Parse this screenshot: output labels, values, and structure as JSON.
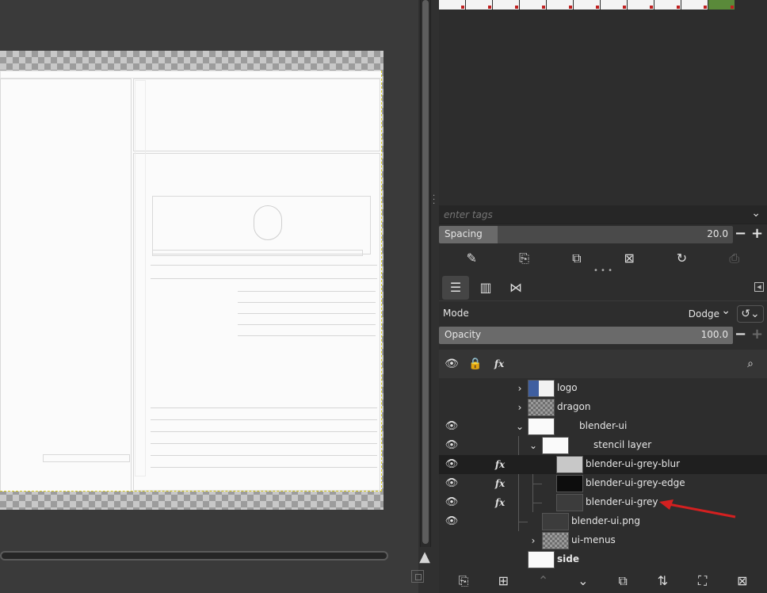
{
  "brushes": {
    "tags_placeholder": "enter tags",
    "spacing_label": "Spacing",
    "spacing_value": "20.0",
    "spacing_fraction": 0.2
  },
  "layers": {
    "mode_label": "Mode",
    "mode_value": "Dodge",
    "opacity_label": "Opacity",
    "opacity_value": "100.0",
    "opacity_fraction": 1.0,
    "items": [
      {
        "name": "logo",
        "visible": false,
        "fx": false,
        "expander": "›",
        "thumb": "t-logo"
      },
      {
        "name": "dragon",
        "visible": false,
        "fx": false,
        "expander": "›",
        "thumb": "t-checker"
      },
      {
        "name": "blender-ui",
        "visible": true,
        "fx": false,
        "expander": "⌄",
        "thumb": "t-white"
      },
      {
        "name": "stencil layer",
        "visible": true,
        "fx": false,
        "expander": "⌄",
        "thumb": "t-white"
      },
      {
        "name": "blender-ui-grey-blur",
        "visible": true,
        "fx": true,
        "expander": "",
        "thumb": "t-grey"
      },
      {
        "name": "blender-ui-grey-edge",
        "visible": true,
        "fx": true,
        "expander": "",
        "thumb": "t-black"
      },
      {
        "name": "blender-ui-grey",
        "visible": true,
        "fx": true,
        "expander": "",
        "thumb": "t-dark"
      },
      {
        "name": "blender-ui.png",
        "visible": true,
        "fx": false,
        "expander": "",
        "thumb": "t-dark"
      },
      {
        "name": "ui-menus",
        "visible": false,
        "fx": false,
        "expander": "›",
        "thumb": "t-checker"
      },
      {
        "name": "side",
        "visible": false,
        "fx": false,
        "expander": "",
        "thumb": "t-white"
      }
    ]
  },
  "icons": {
    "eye": "eye-icon",
    "lock": "lock-icon",
    "fx": "fx-icon",
    "search": "search-icon"
  },
  "colors": {
    "annotation_arrow": "#d32020",
    "selection_outline": "#d8cc20"
  }
}
